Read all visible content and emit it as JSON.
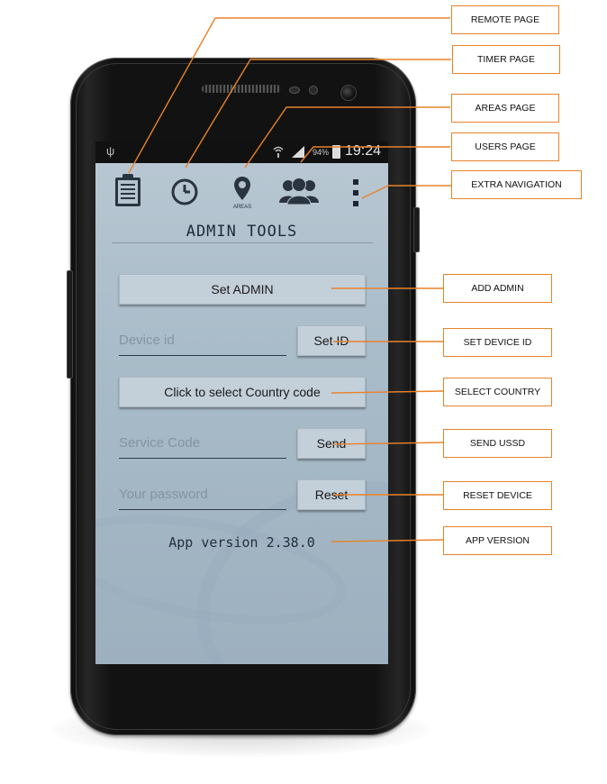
{
  "status_bar": {
    "usb_icon": "usb-icon",
    "battery_percent": "94%",
    "time": "19:24"
  },
  "nav": {
    "areas_label": "AREAS",
    "icons": [
      "clipboard-icon",
      "clock-icon",
      "location-pin-icon",
      "users-icon",
      "overflow-menu-icon"
    ]
  },
  "screen": {
    "title": "ADMIN TOOLS",
    "set_admin_button": "Set ADMIN",
    "device_id_placeholder": "Device id",
    "set_id_button": "Set ID",
    "country_button": "Click to select Country code",
    "service_code_placeholder": "Service Code",
    "send_button": "Send",
    "password_placeholder": "Your password",
    "reset_button": "Reset",
    "version_text": "App version 2.38.0"
  },
  "callouts": {
    "remote_page": "REMOTE PAGE",
    "timer_page": "TIMER PAGE",
    "areas_page": "AREAS PAGE",
    "users_page": "USERS PAGE",
    "extra_navigation": "EXTRA NAVIGATION",
    "add_admin": "ADD ADMIN",
    "set_device_id": "SET DEVICE ID",
    "select_country": "SELECT COUNTRY",
    "send_ussd": "SEND USSD",
    "reset_device": "RESET DEVICE",
    "app_version": "APP VERSION"
  },
  "colors": {
    "callout_line": "#e8822a",
    "screen_bg": "#b9c8d3",
    "button_bg": "#c3cfd9"
  }
}
